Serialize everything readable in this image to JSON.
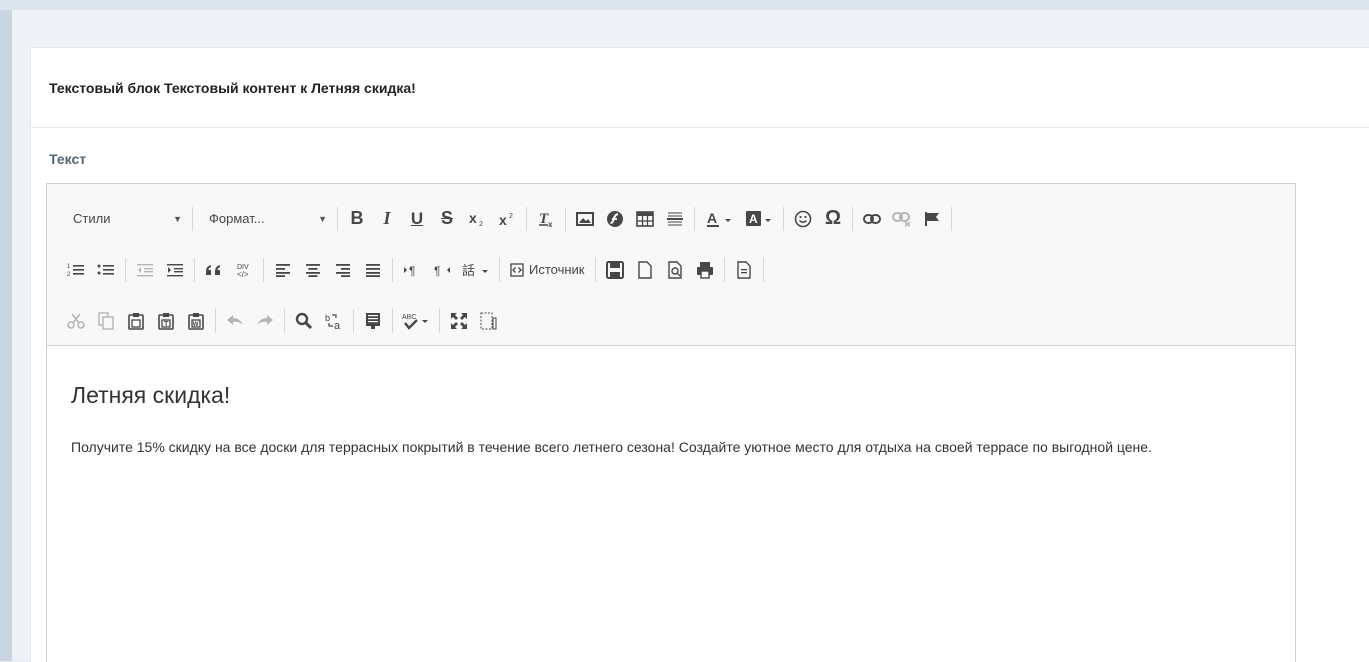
{
  "panel": {
    "title": "Текстовый блок Текстовый контент к Летняя скидка!"
  },
  "field": {
    "label": "Текст"
  },
  "toolbar": {
    "styles_label": "Стили",
    "format_label": "Формат...",
    "bold": "B",
    "italic": "I",
    "underline": "U",
    "strike": "S",
    "omega": "Ω",
    "source_label": "Источник"
  },
  "editor": {
    "heading": "Летняя скидка!",
    "paragraph": "Получите 15% скидку на все доски для террасных покрытий в течение всего летнего сезона! Создайте уютное место для отдыха на своей террасе по выгодной цене."
  }
}
